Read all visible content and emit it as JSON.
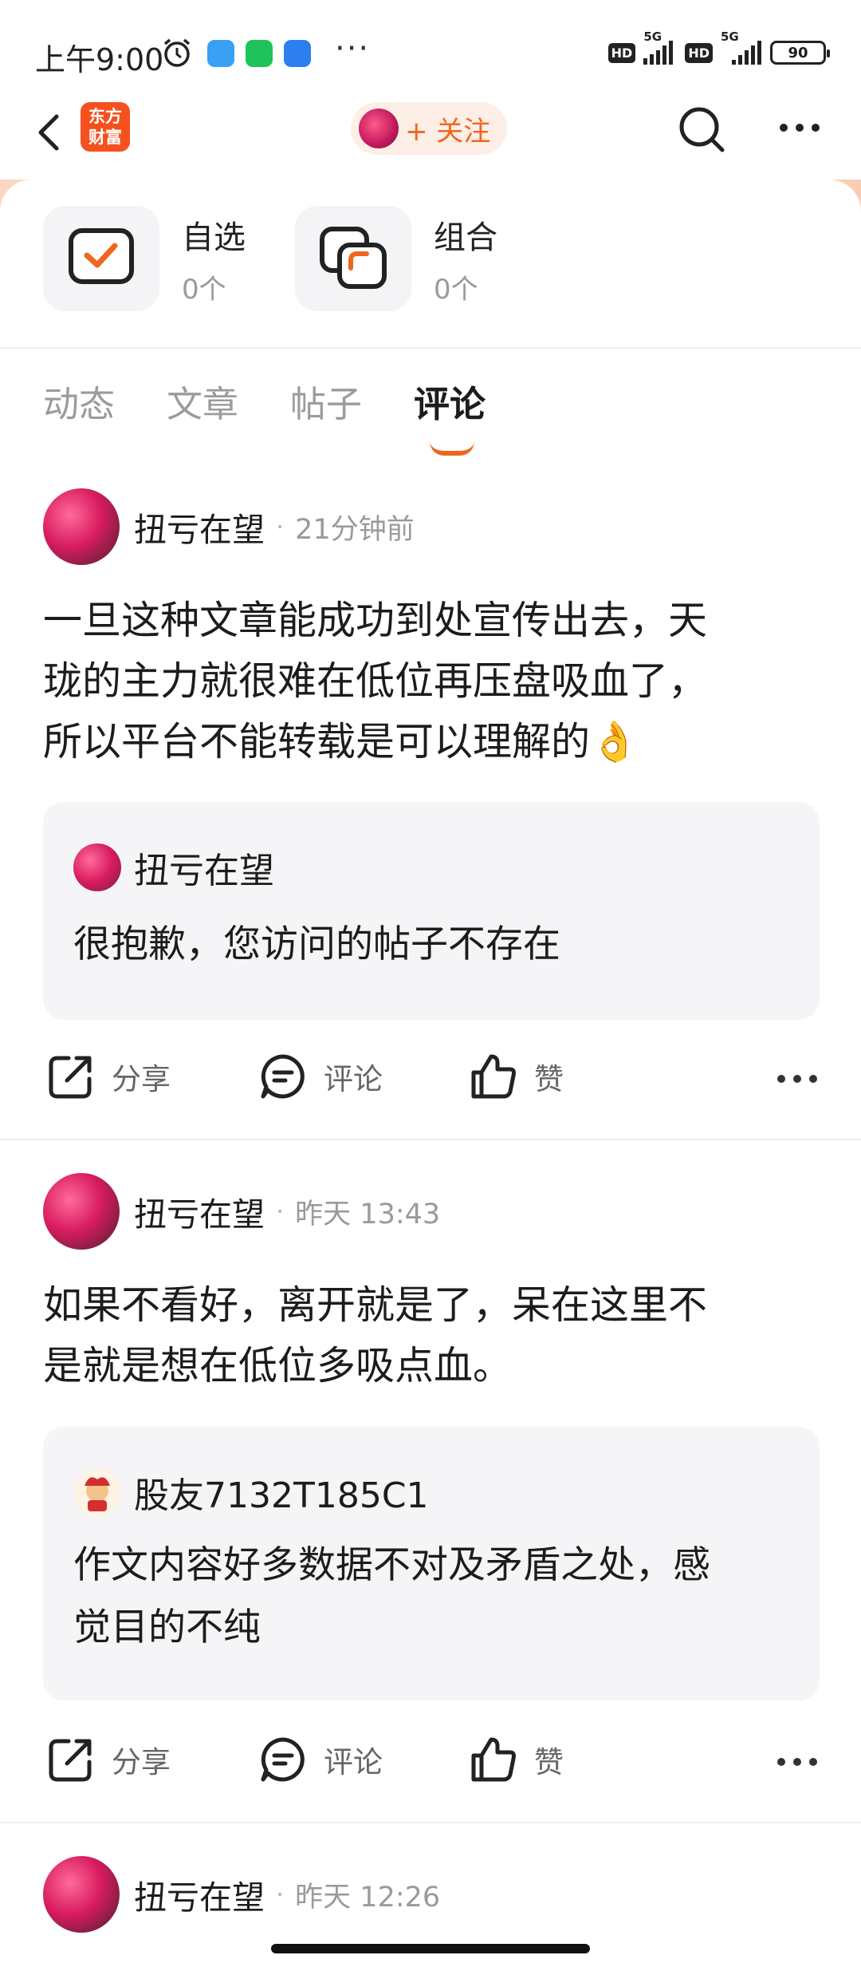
{
  "status_bar": {
    "time": "上午9:00",
    "battery": "90",
    "network": "5G",
    "hd": "HD"
  },
  "nav": {
    "logo_line1": "东方",
    "logo_line2": "财富",
    "follow_label": "+ 关注"
  },
  "portfolio": {
    "items": [
      {
        "title": "自选",
        "count": "0个"
      },
      {
        "title": "组合",
        "count": "0个"
      }
    ]
  },
  "tabs": [
    {
      "label": "动态",
      "active": false
    },
    {
      "label": "文章",
      "active": false
    },
    {
      "label": "帖子",
      "active": false
    },
    {
      "label": "评论",
      "active": true
    }
  ],
  "posts": [
    {
      "author": "扭亏在望",
      "sep": "·",
      "time": "21分钟前",
      "lines": [
        "一旦这种文章能成功到处宣传出去，天",
        "珑的主力就很难在低位再压盘吸血了，",
        "所以平台不能转载是可以理解的👌"
      ],
      "quote_author": "扭亏在望",
      "quote_lines": [
        "很抱歉，您访问的帖子不存在"
      ]
    },
    {
      "author": "扭亏在望",
      "sep": "·",
      "time": "昨天 13:43",
      "lines": [
        "如果不看好，离开就是了，呆在这里不",
        "是就是想在低位多吸点血。"
      ],
      "quote_author": "股友7132T185C1",
      "quote_lines": [
        "作文内容好多数据不对及矛盾之处，感",
        "觉目的不纯"
      ]
    },
    {
      "author": "扭亏在望",
      "sep": "·",
      "time": "昨天 12:26"
    }
  ],
  "actions": {
    "share": "分享",
    "comment": "评论",
    "like": "赞"
  },
  "colors": {
    "accent": "#f0661f",
    "brand": "#f4511e"
  }
}
